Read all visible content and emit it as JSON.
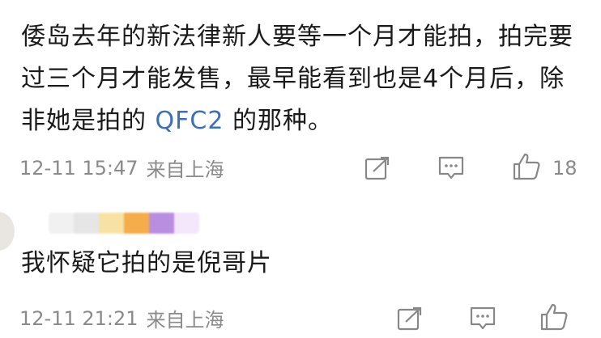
{
  "comments": [
    {
      "text_before_link": "倭岛去年的新法律新人要等一个月才能拍，拍完要过三个月才能发售，最早能看到也是4个月后，除非她是拍的",
      "link_text": "QFC2",
      "text_after_link": "的那种。",
      "timestamp": "12-11 15:47",
      "location": "来自上海",
      "like_count": "18",
      "icons": {
        "share": "share-icon",
        "comment": "comment-icon",
        "like": "like-icon"
      }
    },
    {
      "text": "我怀疑它拍的是倪哥片",
      "timestamp": "12-11 21:21",
      "location": "来自上海",
      "icons": {
        "share": "share-icon",
        "comment": "comment-icon",
        "like": "like-icon"
      },
      "username_blur_colors": [
        "#f1f1f1",
        "#e6e6e6",
        "#f7e2a3",
        "#f4ad4a",
        "#b98de0",
        "#f4e6fb"
      ]
    }
  ]
}
